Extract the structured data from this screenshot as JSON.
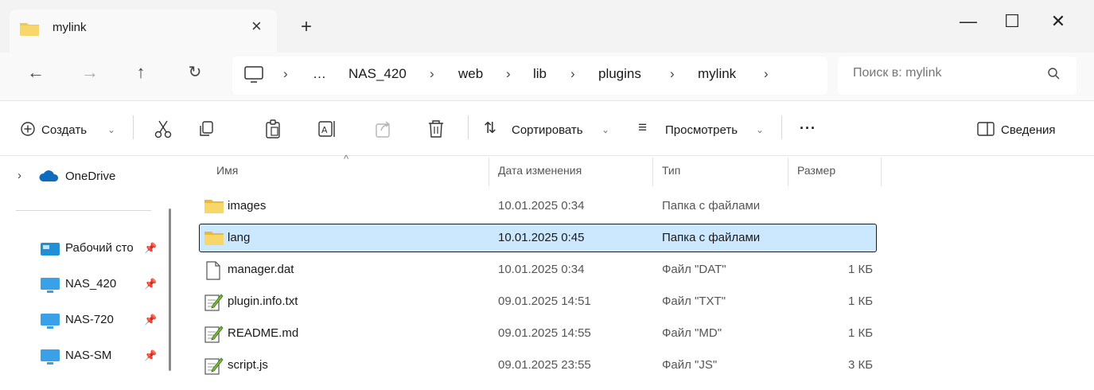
{
  "tab": {
    "title": "mylink"
  },
  "window_controls": {
    "minimize": "—",
    "maximize": "☐",
    "close": "✕"
  },
  "breadcrumbs": [
    "…",
    "NAS_420",
    "web",
    "lib",
    "plugins",
    "mylink"
  ],
  "search": {
    "placeholder": "Поиск в: mylink"
  },
  "toolbar": {
    "create_label": "Создать",
    "sort_label": "Сортировать",
    "view_label": "Просмотреть",
    "more_label": "···",
    "details_label": "Сведения"
  },
  "sidebar": {
    "onedrive": "OneDrive",
    "items": [
      {
        "label": "Рабочий сто",
        "icon": "desktop-icon"
      },
      {
        "label": "NAS_420",
        "icon": "monitor-icon"
      },
      {
        "label": "NAS-720",
        "icon": "monitor-icon"
      },
      {
        "label": "NAS-SM",
        "icon": "monitor-icon"
      }
    ]
  },
  "columns": {
    "name": "Имя",
    "date": "Дата изменения",
    "type": "Тип",
    "size": "Размер"
  },
  "files": [
    {
      "name": "images",
      "date": "10.01.2025 0:34",
      "type": "Папка с файлами",
      "size": "",
      "icon": "folder-icon"
    },
    {
      "name": "lang",
      "date": "10.01.2025 0:45",
      "type": "Папка с файлами",
      "size": "",
      "icon": "folder-icon",
      "selected": true
    },
    {
      "name": "manager.dat",
      "date": "10.01.2025 0:34",
      "type": "Файл \"DAT\"",
      "size": "1 КБ",
      "icon": "file-icon"
    },
    {
      "name": "plugin.info.txt",
      "date": "09.01.2025 14:51",
      "type": "Файл \"TXT\"",
      "size": "1 КБ",
      "icon": "text-file-icon"
    },
    {
      "name": "README.md",
      "date": "09.01.2025 14:55",
      "type": "Файл \"MD\"",
      "size": "1 КБ",
      "icon": "text-file-icon"
    },
    {
      "name": "script.js",
      "date": "09.01.2025 23:55",
      "type": "Файл \"JS\"",
      "size": "3 КБ",
      "icon": "text-file-icon"
    }
  ],
  "colors": {
    "folder": "#f2c94c",
    "selected_row": "#cce8ff",
    "selected_border": "#1a1a1a",
    "onedrive": "#0f6cbd"
  }
}
